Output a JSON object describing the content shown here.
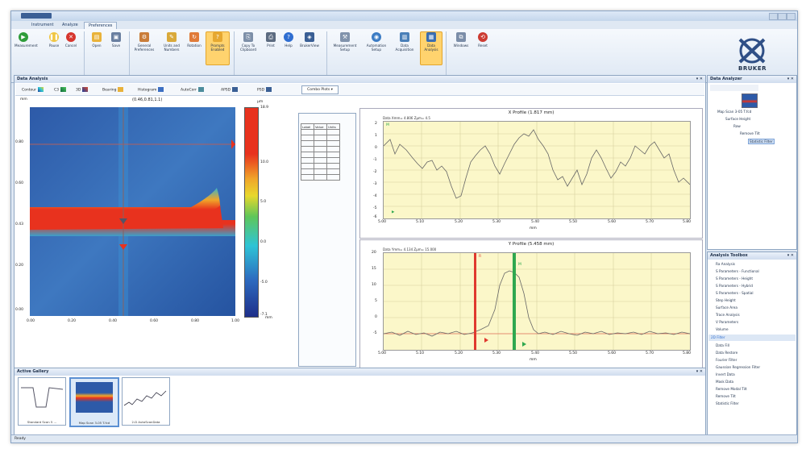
{
  "window": {
    "tabs": [
      "Instrument",
      "Analyze",
      "Preferences"
    ],
    "active_tab": "Preferences"
  },
  "ribbon": {
    "buttons": {
      "measurement": "Measurement",
      "pause": "Pause",
      "cancel": "Cancel",
      "open": "Open",
      "save": "Save",
      "general_preferences": "General Preferences",
      "units_numbers": "Units and Numbers",
      "rotation": "Rotation",
      "prompts": "Prompts Enabled",
      "copy": "Copy To Clipboard",
      "print": "Print",
      "help": "Help",
      "brukerview": "BrukerView",
      "measurement_setup": "Measurement Setup",
      "automation_setup": "Automation Setup",
      "data_acquisition": "Data Acquisition",
      "data_analysis": "Data Analysis",
      "windows": "Windows",
      "reset": "Reset"
    },
    "groups": {
      "measurement": "Measurement",
      "file": "File",
      "user_preferences": "User Preferences",
      "miscellaneous": "Miscellaneous",
      "current_view": "Current View",
      "current_windows": "Current Windows"
    },
    "logo_text": "BRUKER"
  },
  "data_analysis": {
    "title": "Data Analysis",
    "toolbar": [
      "Contour",
      "C3",
      "3D",
      "Bearing",
      "Histogram",
      "AutoCorr",
      "APSD",
      "PSD"
    ],
    "combo": "Combo Plots",
    "map": {
      "header_left": "mm",
      "header_coords": "(0.46,0.81,1.1)",
      "unit": "μm",
      "y_ticks": [
        "0.80",
        "0.60",
        "0.43",
        "0.20",
        "0.00"
      ],
      "x_ticks": [
        "0.00",
        "0.20",
        "0.40",
        "0.60",
        "0.80",
        "1.00"
      ],
      "x_unit": "mm",
      "colorbar_ticks": [
        "18.9",
        "10.0",
        "5.0",
        "0.0",
        "-5.0",
        "-7.1"
      ]
    },
    "param_table": {
      "headers": [
        "Label",
        "Value",
        "Units"
      ]
    },
    "x_profile": {
      "title": "X Profile (1.817 mm)",
      "subtitle": "Data  Xmm= 4.806  Zμm= 4.5",
      "x_ticks": [
        "5.00",
        "5.10",
        "5.20",
        "5.30",
        "5.40",
        "5.50",
        "5.60",
        "5.70",
        "5.80"
      ],
      "y_ticks": [
        "2",
        "1",
        "0",
        "-1",
        "-2",
        "-3",
        "-4",
        "-5",
        "-6"
      ],
      "x_unit": "mm",
      "marker_m": "M"
    },
    "y_profile": {
      "title": "Y Profile (5.458 mm)",
      "subtitle": "Data  Ymm= 4.134  Zμm= 15.000",
      "x_ticks": [
        "5.00",
        "5.10",
        "5.20",
        "5.30",
        "5.40",
        "5.50",
        "5.60",
        "5.70",
        "5.80"
      ],
      "y_ticks": [
        "20",
        "15",
        "10",
        "5",
        "0",
        "-5"
      ],
      "x_unit": "mm",
      "marker_r": "R",
      "marker_m": "M"
    }
  },
  "data_analyzer": {
    "title": "Data Analyzer",
    "tree": [
      "Map Scan 3-05 T.fcd",
      "Surface Height",
      "Raw",
      "Remove Tilt",
      "Statistic Filter"
    ]
  },
  "analysis_toolbox": {
    "title": "Analysis Toolbox",
    "items": [
      "Ra Analysis",
      "S Parameters - Functional",
      "S Parameters - Height",
      "S Parameters - Hybrid",
      "S Parameters - Spatial",
      "Step Height",
      "Surface Area",
      "Trace Analysis",
      "V Parameters",
      "Volume"
    ],
    "section": "2D Filter",
    "filters": [
      "Data Fill",
      "Data Restore",
      "Fourier Filter",
      "Gaussian Regression Filter",
      "Invert Data",
      "Mask Data",
      "Remove Modal Tilt",
      "Remove Tilt",
      "Statistic Filter"
    ]
  },
  "active_gallery": {
    "title": "Active Gallery",
    "items": [
      "Standard Scan 5 ...",
      "Map Scan 3-05 T.fcd",
      "2-D AutoScanData"
    ]
  },
  "status": "Ready",
  "colors": {
    "accent": "#3a5f95",
    "plot_bg": "#fbf7c9",
    "red_cursor": "#e03a2f",
    "green_cursor": "#2fa84f"
  }
}
